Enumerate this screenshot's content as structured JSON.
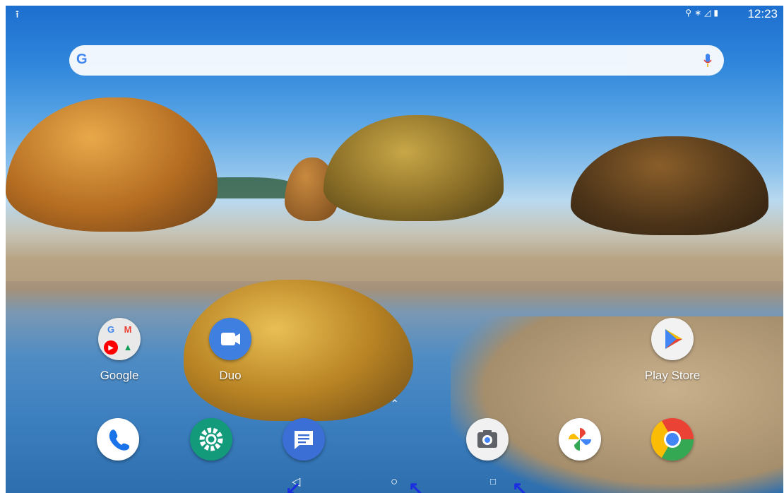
{
  "status_bar": {
    "time": "12:23",
    "left_icon": "upload-icon",
    "right_icons": [
      "location-icon",
      "bluetooth-icon",
      "signal-icon",
      "battery-icon"
    ]
  },
  "search_bar": {
    "logo": "G",
    "mic_icon": "mic-icon"
  },
  "home_apps": [
    {
      "label": "Google",
      "icon": "google-folder-icon"
    },
    {
      "label": "Duo",
      "icon": "duo-icon"
    },
    {
      "label": "Play Store",
      "icon": "play-store-icon"
    }
  ],
  "dock_apps": [
    {
      "icon": "phone-icon"
    },
    {
      "icon": "settings-icon"
    },
    {
      "icon": "messages-icon"
    },
    {
      "icon": "camera-icon"
    },
    {
      "icon": "photos-icon"
    },
    {
      "icon": "chrome-icon"
    }
  ],
  "nav_bar": {
    "back": "◁",
    "home": "○",
    "recents": "□"
  },
  "colors": {
    "duo": "#3f7fe0",
    "phone": "#ffffff",
    "settings": "#139a7a",
    "messages": "#3b6fd6",
    "pointer": "#1b2fe0"
  }
}
